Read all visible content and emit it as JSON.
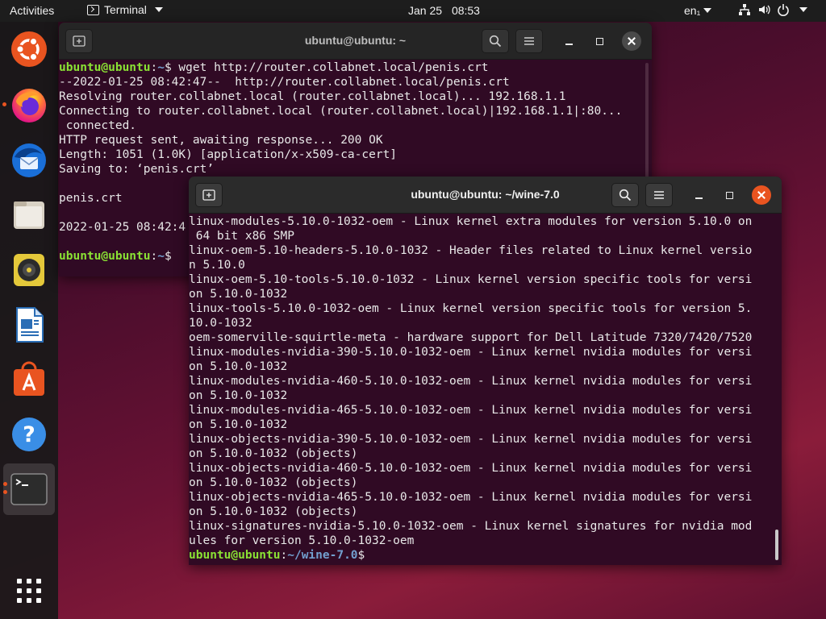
{
  "topbar": {
    "activities": "Activities",
    "app_name": "Terminal",
    "date": "Jan 25",
    "time": "08:53",
    "lang": "en₁",
    "icons": [
      "network-icon",
      "volume-icon",
      "power-icon"
    ]
  },
  "dock": {
    "items": [
      {
        "name": "ubuntu-logo-icon",
        "label": "Ubuntu"
      },
      {
        "name": "firefox-icon",
        "label": "Firefox"
      },
      {
        "name": "thunderbird-icon",
        "label": "Thunderbird"
      },
      {
        "name": "files-icon",
        "label": "Files"
      },
      {
        "name": "rhythmbox-icon",
        "label": "Rhythmbox"
      },
      {
        "name": "libreoffice-writer-icon",
        "label": "LibreOffice Writer"
      },
      {
        "name": "software-center-icon",
        "label": "Ubuntu Software"
      },
      {
        "name": "help-icon",
        "label": "Help"
      },
      {
        "name": "terminal-icon",
        "label": "Terminal"
      },
      {
        "name": "show-apps-icon",
        "label": "Show Applications"
      }
    ]
  },
  "back_window": {
    "title": "ubuntu@ubuntu: ~",
    "lines": [
      {
        "user": "ubuntu@ubuntu",
        "path": "~",
        "text": "$ wget http://router.collabnet.local/penis.crt"
      },
      {
        "text": "--2022-01-25 08:42:47--  http://router.collabnet.local/penis.crt"
      },
      {
        "text": "Resolving router.collabnet.local (router.collabnet.local)... 192.168.1.1"
      },
      {
        "text": "Connecting to router.collabnet.local (router.collabnet.local)|192.168.1.1|:80..."
      },
      {
        "text": " connected."
      },
      {
        "text": "HTTP request sent, awaiting response... 200 OK"
      },
      {
        "text": "Length: 1051 (1.0K) [application/x-x509-ca-cert]"
      },
      {
        "text": "Saving to: ‘penis.crt’"
      },
      {
        "text": ""
      },
      {
        "text": "penis.crt"
      },
      {
        "text": ""
      },
      {
        "text": "2022-01-25 08:42:4"
      },
      {
        "text": ""
      },
      {
        "user": "ubuntu@ubuntu",
        "path": "~",
        "text": "$ "
      }
    ]
  },
  "front_window": {
    "title": "ubuntu@ubuntu: ~/wine-7.0",
    "lines": [
      {
        "text": "linux-modules-5.10.0-1032-oem - Linux kernel extra modules for version 5.10.0 on"
      },
      {
        "text": " 64 bit x86 SMP"
      },
      {
        "text": "linux-oem-5.10-headers-5.10.0-1032 - Header files related to Linux kernel versio"
      },
      {
        "text": "n 5.10.0"
      },
      {
        "text": "linux-oem-5.10-tools-5.10.0-1032 - Linux kernel version specific tools for versi"
      },
      {
        "text": "on 5.10.0-1032"
      },
      {
        "text": "linux-tools-5.10.0-1032-oem - Linux kernel version specific tools for version 5."
      },
      {
        "text": "10.0-1032"
      },
      {
        "text": "oem-somerville-squirtle-meta - hardware support for Dell Latitude 7320/7420/7520"
      },
      {
        "text": "linux-modules-nvidia-390-5.10.0-1032-oem - Linux kernel nvidia modules for versi"
      },
      {
        "text": "on 5.10.0-1032"
      },
      {
        "text": "linux-modules-nvidia-460-5.10.0-1032-oem - Linux kernel nvidia modules for versi"
      },
      {
        "text": "on 5.10.0-1032"
      },
      {
        "text": "linux-modules-nvidia-465-5.10.0-1032-oem - Linux kernel nvidia modules for versi"
      },
      {
        "text": "on 5.10.0-1032"
      },
      {
        "text": "linux-objects-nvidia-390-5.10.0-1032-oem - Linux kernel nvidia modules for versi"
      },
      {
        "text": "on 5.10.0-1032 (objects)"
      },
      {
        "text": "linux-objects-nvidia-460-5.10.0-1032-oem - Linux kernel nvidia modules for versi"
      },
      {
        "text": "on 5.10.0-1032 (objects)"
      },
      {
        "text": "linux-objects-nvidia-465-5.10.0-1032-oem - Linux kernel nvidia modules for versi"
      },
      {
        "text": "on 5.10.0-1032 (objects)"
      },
      {
        "text": "linux-signatures-nvidia-5.10.0-1032-oem - Linux kernel signatures for nvidia mod"
      },
      {
        "text": "ules for version 5.10.0-1032-oem"
      },
      {
        "user": "ubuntu@ubuntu",
        "path": "~/wine-7.0",
        "text": "$ "
      }
    ]
  },
  "colors": {
    "terminal_bg": "#300a24",
    "prompt_user": "#8ae234",
    "prompt_path": "#729fcf",
    "accent": "#e95420"
  }
}
